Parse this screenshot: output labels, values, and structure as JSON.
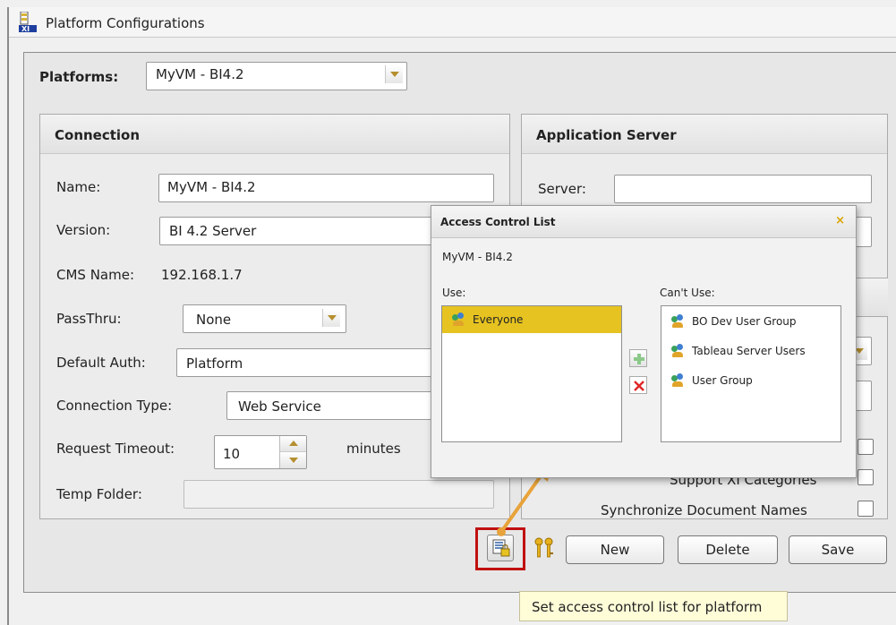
{
  "window": {
    "title": "Platform Configurations",
    "icon": "platform-config-icon"
  },
  "platforms": {
    "label": "Platforms:",
    "selected": "MyVM - BI4.2"
  },
  "connection": {
    "heading": "Connection",
    "name_label": "Name:",
    "name_value": "MyVM - BI4.2",
    "version_label": "Version:",
    "version_value": "BI 4.2 Server",
    "cms_label": "CMS Name:",
    "cms_value": "192.168.1.7",
    "passthru_label": "PassThru:",
    "passthru_value": "None",
    "default_auth_label": "Default Auth:",
    "default_auth_value": "Platform",
    "connection_type_label": "Connection Type:",
    "connection_type_value": "Web Service",
    "timeout_label": "Request Timeout:",
    "timeout_value": "10",
    "timeout_unit": "minutes",
    "temp_folder_label": "Temp Folder:",
    "temp_folder_value": ""
  },
  "app_server": {
    "heading": "Application Server",
    "server_label": "Server:",
    "server_value": "",
    "support_xi_label": "Support XI Categories",
    "sync_names_label": "Synchronize Document Names"
  },
  "toolbar": {
    "new_label": "New",
    "delete_label": "Delete",
    "save_label": "Save"
  },
  "acl_dialog": {
    "title": "Access Control List",
    "close_glyph": "×",
    "platform_name": "MyVM - BI4.2",
    "use_label": "Use:",
    "cant_use_label": "Can't Use:",
    "use_items": [
      "Everyone"
    ],
    "cant_use_items": [
      "BO Dev User Group",
      "Tableau Server Users",
      "User Group"
    ]
  },
  "tooltip": {
    "text": "Set access control list for platform"
  },
  "colors": {
    "selection": "#e6c321",
    "accent_gold": "#b58f2e",
    "highlight_red": "#c01010",
    "arrow_orange": "#e8a33a",
    "tooltip_bg": "#fffcd8"
  }
}
